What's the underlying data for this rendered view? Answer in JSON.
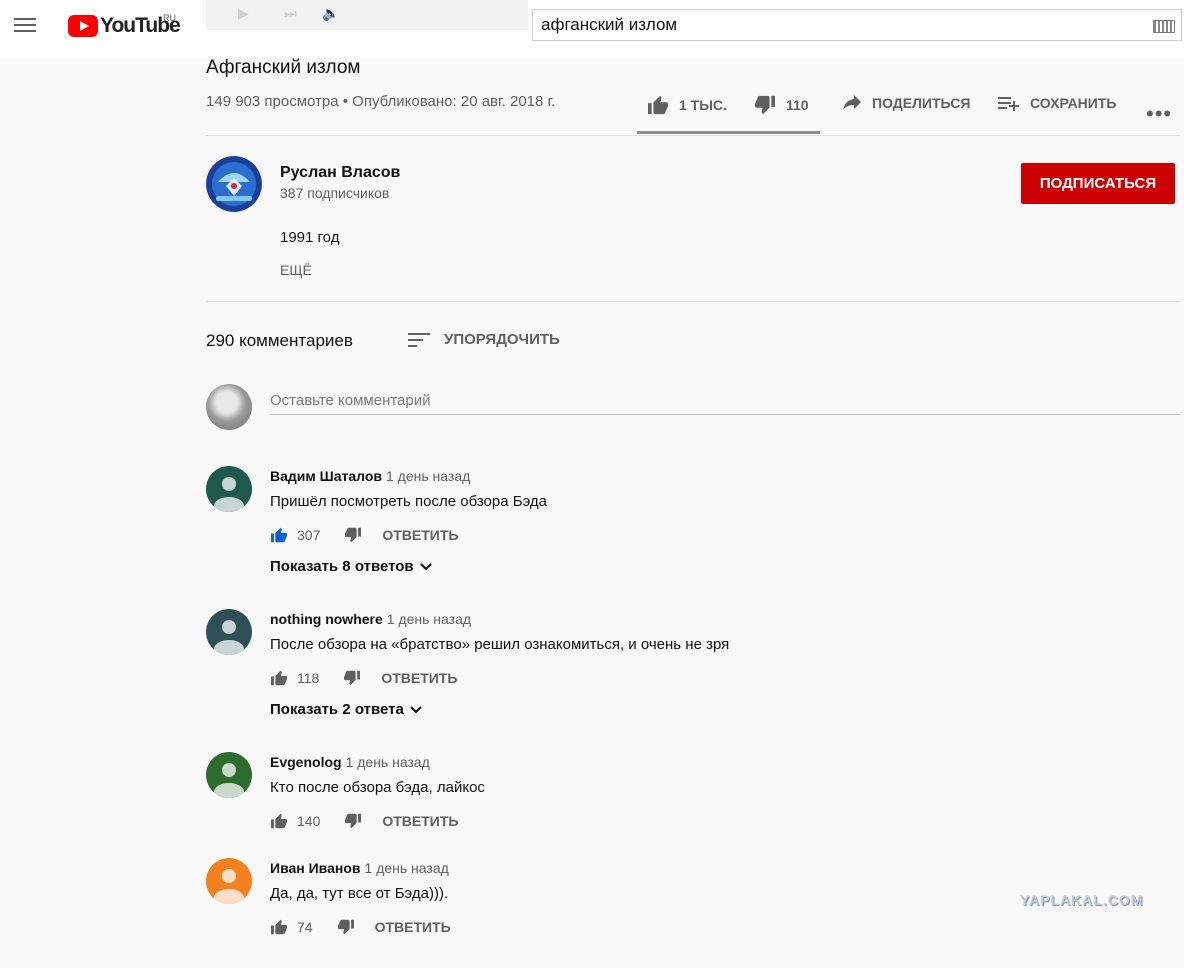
{
  "masthead": {
    "logo_text": "YouTube",
    "region": "RU",
    "search_value": "афганский излом"
  },
  "video": {
    "title": "Афганский излом",
    "meta": "149 903 просмотра • Опубликовано: 20 авг. 2018 г.",
    "likes": "1 ТЫС.",
    "dislikes": "110",
    "like_ratio": 0.9,
    "share_label": "ПОДЕЛИТЬСЯ",
    "save_label": "СОХРАНИТЬ",
    "more": "•••"
  },
  "channel": {
    "name": "Руслан Власов",
    "subscribers": "387 подписчиков",
    "subscribe_label": "ПОДПИСАТЬСЯ",
    "description": "1991 год",
    "more_label": "ЕЩЁ"
  },
  "comments": {
    "count_label": "290 комментариев",
    "sort_label": "УПОРЯДОЧИТЬ",
    "input_placeholder": "Оставьте комментарий",
    "reply_label": "ОТВЕТИТЬ",
    "items": [
      {
        "author": "Вадим Шаталов",
        "time": "1 день назад",
        "text": "Пришёл посмотреть после обзора Бэда",
        "likes": "307",
        "replies": "Показать 8 ответов",
        "avatar_color": "#1e5a4c",
        "liked": true
      },
      {
        "author": "nothing nowhere",
        "time": "1 день назад",
        "text": "После обзора на «братство» решил ознакомиться, и очень не зря",
        "likes": "118",
        "replies": "Показать 2 ответа",
        "avatar_color": "#2f4f57",
        "liked": false
      },
      {
        "author": "Evgenolog",
        "time": "1 день назад",
        "text": "Кто после обзора бэда, лайкос",
        "likes": "140",
        "replies": "",
        "avatar_color": "#2e6b2e",
        "liked": false
      },
      {
        "author": "Иван Иванов",
        "time": "1 день назад",
        "text": "Да, да, тут все от Бэда))).",
        "likes": "74",
        "replies": "",
        "avatar_color": "#f4801f",
        "liked": false
      }
    ]
  },
  "watermark": "YAPLAKAL.COM",
  "colors": {
    "subscribe": "#cc0000",
    "liked": "#065fd4",
    "text_secondary": "#606060"
  }
}
